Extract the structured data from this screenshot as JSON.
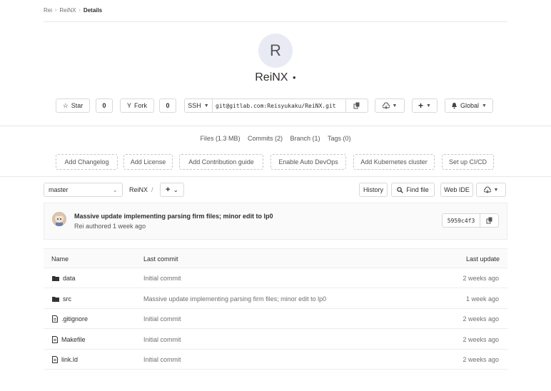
{
  "breadcrumb": {
    "items": [
      "Rei",
      "ReiNX"
    ],
    "current": "Details"
  },
  "project": {
    "avatar_letter": "R",
    "name": "ReiNX"
  },
  "actions": {
    "star_label": "Star",
    "star_count": "0",
    "fork_label": "Fork",
    "fork_count": "0",
    "clone_protocol": "SSH",
    "clone_url": "git@gitlab.com:Reisyukaku/ReiNX.git",
    "notification_label": "Global"
  },
  "stats": {
    "files": "Files (1.3 MB)",
    "commits": "Commits (2)",
    "branch": "Branch (1)",
    "tags": "Tags (0)"
  },
  "quick_actions": [
    "Add Changelog",
    "Add License",
    "Add Contribution guide",
    "Enable Auto DevOps",
    "Add Kubernetes cluster",
    "Set up CI/CD"
  ],
  "tree_nav": {
    "branch": "master",
    "path_root": "ReiNX",
    "path_sep": "/",
    "history_label": "History",
    "find_file_label": "Find file",
    "web_ide_label": "Web IDE"
  },
  "last_commit": {
    "message": "Massive update implementing parsing firm files; minor edit to lp0",
    "meta": "Rei authored 1 week ago",
    "sha": "5959c4f3"
  },
  "table": {
    "headers": {
      "name": "Name",
      "last_commit": "Last commit",
      "last_update": "Last update"
    },
    "rows": [
      {
        "name": "data",
        "icon": "folder-icon",
        "commit": "Initial commit",
        "date": "2 weeks ago"
      },
      {
        "name": "src",
        "icon": "folder-icon",
        "commit": "Massive update implementing parsing firm files; minor edit to lp0",
        "date": "1 week ago"
      },
      {
        "name": ".gitignore",
        "icon": "file-icon",
        "commit": "Initial commit",
        "date": "2 weeks ago"
      },
      {
        "name": "Makefile",
        "icon": "file-icon",
        "commit": "Initial commit",
        "date": "2 weeks ago"
      },
      {
        "name": "link.ld",
        "icon": "file-icon",
        "commit": "Initial commit",
        "date": "2 weeks ago"
      }
    ]
  }
}
